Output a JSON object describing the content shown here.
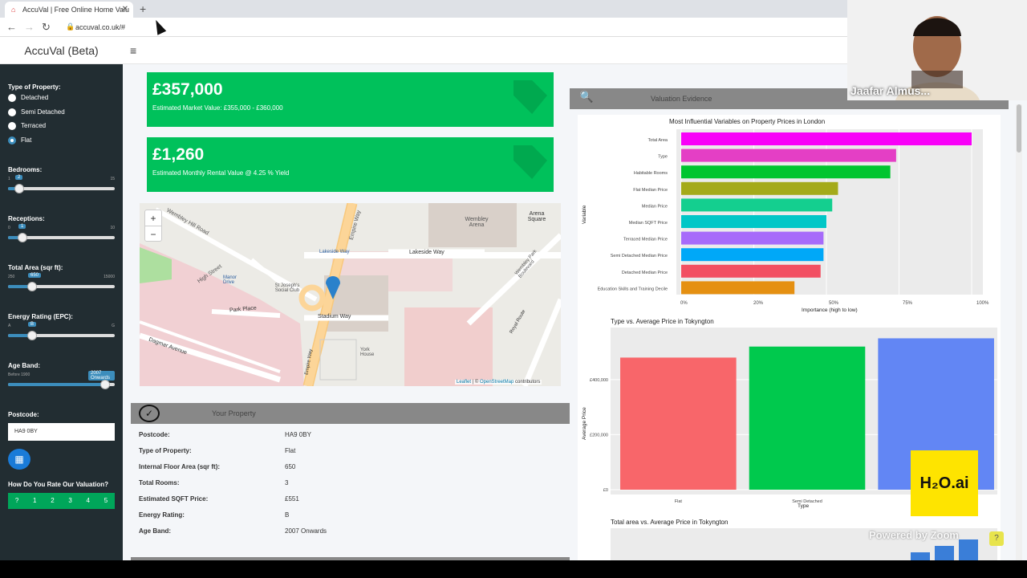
{
  "browser": {
    "tab_title": "AccuVal | Free Online Home Valu",
    "url": "accuval.co.uk/#",
    "new_tab": "+",
    "close": "✕"
  },
  "app": {
    "brand": "AccuVal (Beta)",
    "menu_icon": "≡"
  },
  "sidebar": {
    "type_label": "Type of Property:",
    "types": [
      "Detached",
      "Semi Detached",
      "Terraced",
      "Flat"
    ],
    "selected_type": "Flat",
    "bedrooms": {
      "label": "Bedrooms:",
      "min": "1",
      "max": "15",
      "value": "2",
      "fraction": 0.07
    },
    "receptions": {
      "label": "Receptions:",
      "min": "0",
      "max": "10",
      "value": "1",
      "fraction": 0.1
    },
    "area": {
      "label": "Total Area (sqr ft):",
      "min": "250",
      "max": "15000",
      "value": "650",
      "fraction": 0.2
    },
    "epc": {
      "label": "Energy Rating (EPC):",
      "min": "A",
      "max": "G",
      "value": "B",
      "fraction": 0.2
    },
    "age": {
      "label": "Age Band:",
      "min": "Before 1900",
      "value": "2007 Onwards",
      "fraction": 0.95
    },
    "postcode_label": "Postcode:",
    "postcode_value": "HA9 0BY",
    "calc_icon": "▦",
    "rating_label": "How Do You Rate Our Valuation?",
    "ratings": [
      "?",
      "1",
      "2",
      "3",
      "4",
      "5"
    ]
  },
  "valuation": {
    "price": "£357,000",
    "price_sub": "Estimated Market Value: £355,000 - £360,000",
    "rent": "£1,260",
    "rent_sub": "Estimated Monthly Rental Value @ 4.25 % Yield"
  },
  "map": {
    "zoom_in": "+",
    "zoom_out": "−",
    "labels": [
      "Wembley Hill Road",
      "Empire Way",
      "Lakeside Way",
      "Lakeside Way",
      "Wembley Arena",
      "Arena Square",
      "Wembley Park Boulevard",
      "High Street",
      "Manor Drive",
      "St Joseph's Social Club",
      "Park Place",
      "Stadium Way",
      "Dagmar Avenue",
      "York House",
      "Royal Route",
      "Empire Way"
    ],
    "attribution_leaflet": "Leaflet",
    "attribution_sep": " | © ",
    "attribution_osm": "OpenStreetMap",
    "attribution_tail": " contributors"
  },
  "property": {
    "title": "Your Property",
    "rows": [
      {
        "k": "Postcode:",
        "v": "HA9 0BY"
      },
      {
        "k": "Type of Property:",
        "v": "Flat"
      },
      {
        "k": "Internal Floor Area (sqr ft):",
        "v": "650"
      },
      {
        "k": "Total Rooms:",
        "v": "3"
      },
      {
        "k": "Estimated SQFT Price:",
        "v": "£551"
      },
      {
        "k": "Energy Rating:",
        "v": "B"
      },
      {
        "k": "Age Band:",
        "v": "2007 Onwards"
      }
    ]
  },
  "evidence": {
    "title": "Valuation Evidence"
  },
  "charts": {
    "c1_title": "Most Influential Variables on Property Prices in London",
    "c1_ylabel": "Variable",
    "c1_xlabel": "Importance (high to low)",
    "c1_ticks": [
      "0%",
      "20%",
      "50%",
      "75%",
      "100%"
    ],
    "c2_title": "Type vs. Average Price in Tokyngton",
    "c2_ylabel": "Average Price",
    "c2_xlabel": "Type",
    "c2_yticks": [
      "£400,000",
      "£200,000",
      "£0"
    ],
    "c2_cats": [
      "Flat",
      "Semi Detached",
      "Te"
    ],
    "c3_title": "Total area vs. Average Price in Tokyngton"
  },
  "chart_data": [
    {
      "type": "bar",
      "title": "Most Influential Variables on Property Prices in London",
      "xlabel": "Importance (high to low)",
      "ylabel": "Variable",
      "categories": [
        "Total Area",
        "Type",
        "Habitable Rooms",
        "Flat Median Price",
        "Median Price",
        "Median SQFT Price",
        "Terraced Median Price",
        "Semi Detached Median Price",
        "Detached Median Price",
        "Education Skills and Training Decile"
      ],
      "values": [
        100,
        74,
        72,
        54,
        52,
        50,
        49,
        49,
        48,
        39
      ],
      "colors": [
        "#f800f8",
        "#e43fc5",
        "#00c52f",
        "#a4aa1a",
        "#14cf8f",
        "#00c7c7",
        "#a76bfa",
        "#00a8f8",
        "#f24f62",
        "#e59012"
      ],
      "xlim": [
        0,
        100
      ],
      "orientation": "horizontal"
    },
    {
      "type": "bar",
      "title": "Type vs. Average Price in Tokyngton",
      "xlabel": "Type",
      "ylabel": "Average Price",
      "categories": [
        "Flat",
        "Semi Detached",
        "Te"
      ],
      "values": [
        480000,
        520000,
        550000
      ],
      "colors": [
        "#f8666a",
        "#00c94d",
        "#6286f4"
      ],
      "ylim": [
        0,
        560000
      ]
    }
  ],
  "overlay": {
    "video_name": "Jaafar Almus...",
    "zoom": "Powered by Zoom",
    "h2o": "H₂O.ai",
    "help": "?"
  }
}
